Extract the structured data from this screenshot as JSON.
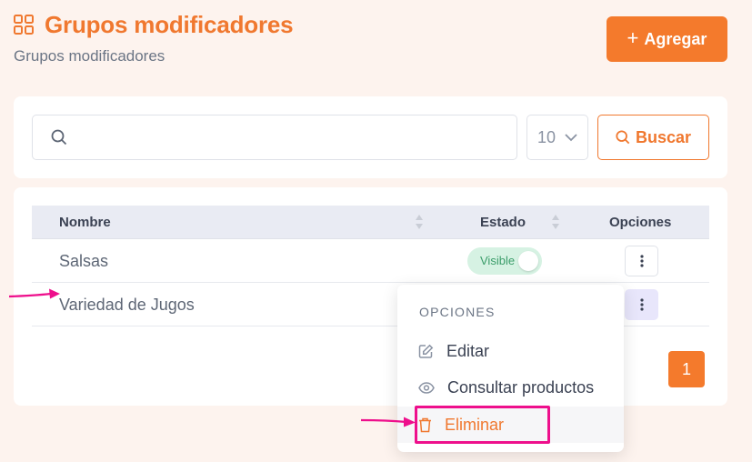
{
  "header": {
    "title": "Grupos modificadores",
    "subtitle": "Grupos modificadores",
    "add_label": "Agregar",
    "add_symbol": "+"
  },
  "search": {
    "placeholder": "",
    "value": "",
    "page_size": "10",
    "button_label": "Buscar"
  },
  "table": {
    "columns": [
      "Nombre",
      "Estado",
      "Opciones"
    ],
    "rows": [
      {
        "name": "Salsas",
        "status": "Visible"
      },
      {
        "name": "Variedad de Jugos",
        "status": ""
      }
    ]
  },
  "pagination": {
    "current": "1"
  },
  "dropdown": {
    "title": "OPCIONES",
    "items": [
      "Editar",
      "Consultar productos",
      "Eliminar"
    ]
  },
  "colors": {
    "accent": "#f47a2c",
    "background": "#fdf3ee",
    "annotation": "#ee0f8c",
    "status_bg": "#d6f2e3",
    "status_text": "#3b9d6a"
  },
  "icons": [
    "grid-icon",
    "plus-icon",
    "search-icon",
    "chevron-down-icon",
    "sort-icon",
    "kebab-icon",
    "edit-icon",
    "eye-icon",
    "trash-icon"
  ]
}
